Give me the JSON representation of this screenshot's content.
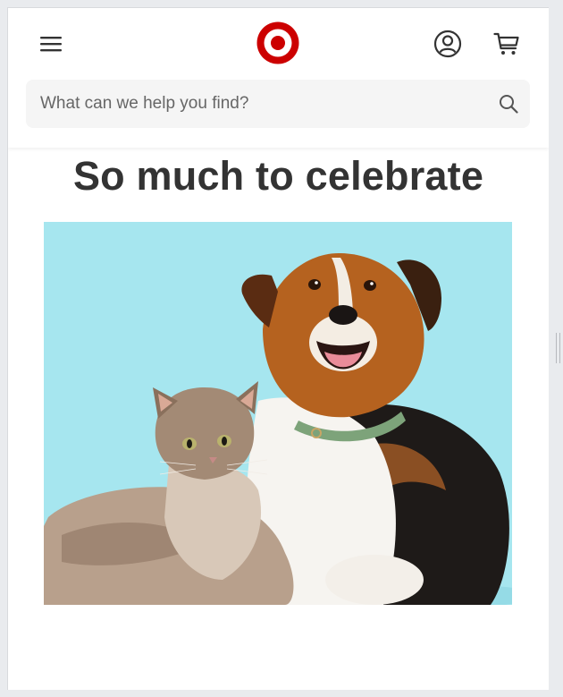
{
  "header": {
    "menu_icon": "menu-icon",
    "logo_icon": "target-bullseye-logo",
    "account_icon": "account-icon",
    "cart_icon": "cart-icon"
  },
  "search": {
    "placeholder": "What can we help you find?",
    "icon": "search-icon"
  },
  "hero": {
    "title": "So much to celebrate",
    "image_subject": "dog-and-cat-pet-photo"
  },
  "colors": {
    "brand_red": "#cc0000",
    "text_dark": "#333333",
    "hero_bg": "#a6e6ef",
    "search_bg": "#f5f5f5"
  }
}
